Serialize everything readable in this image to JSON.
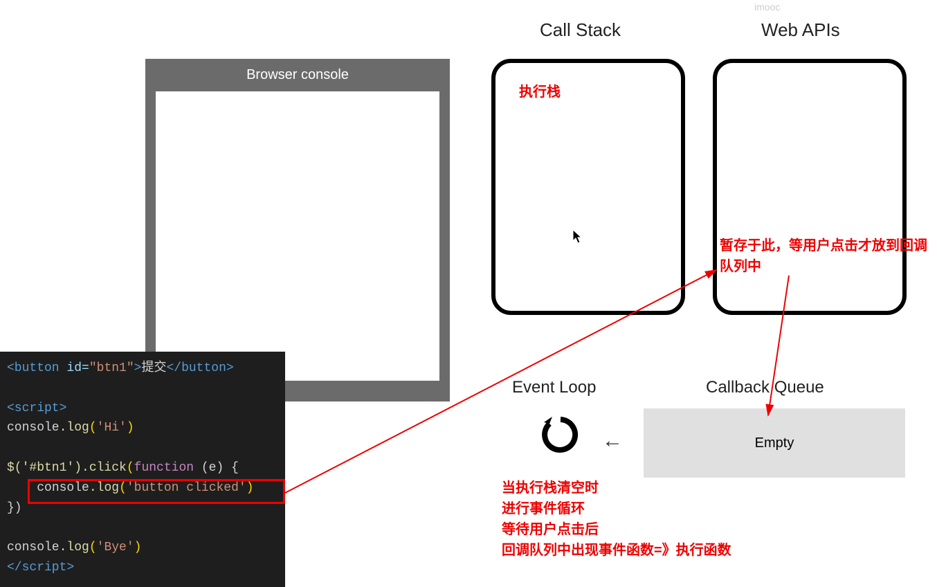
{
  "watermark": "imooc",
  "headings": {
    "call_stack": "Call Stack",
    "web_apis": "Web APIs",
    "event_loop": "Event Loop",
    "callback_queue": "Callback Queue"
  },
  "console_title": "Browser console",
  "callback_content": "Empty",
  "annotations": {
    "call_stack_note": "执行栈",
    "web_apis_note": "暂存于此，等用户点击才放到回调队列中",
    "event_loop_note": "当执行栈清空时\n进行事件循环\n等待用户点击后\n回调队列中出现事件函数=》执行函数"
  },
  "code": {
    "line1_open": "<button",
    "line1_attr": " id=",
    "line1_val": "\"btn1\"",
    "line1_close": ">",
    "line1_text": "提交",
    "line1_end": "</button>",
    "line2": "<script>",
    "line3_obj": "console",
    "line3_fn": ".log",
    "line3_arg": "'Hi'",
    "line4_sel": "$('#btn1')",
    "line4_click": ".click",
    "line4_fn": "function",
    "line4_param": " (e) {",
    "line5_obj": "console",
    "line5_fn": ".log",
    "line5_arg": "'button clicked'",
    "line6": "})",
    "line7_obj": "console",
    "line7_fn": ".log",
    "line7_arg": "'Bye'",
    "line8": "</script>"
  }
}
